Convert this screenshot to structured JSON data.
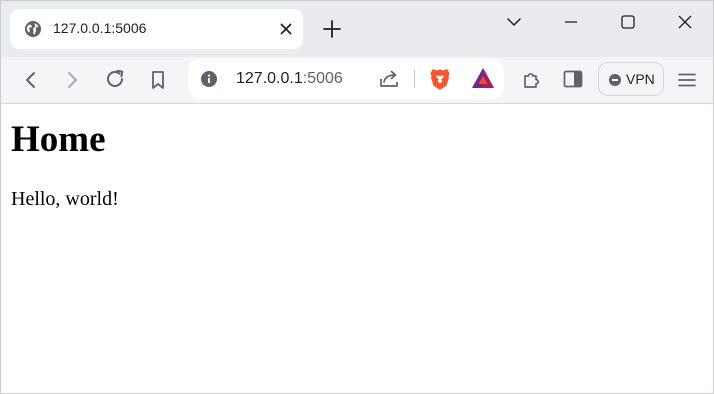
{
  "tab": {
    "title": "127.0.0.1:5006",
    "favicon": "globe-icon"
  },
  "address_bar": {
    "host": "127.0.0.1",
    "port": ":5006"
  },
  "toolbar": {
    "vpn_label": "VPN"
  },
  "page": {
    "heading": "Home",
    "paragraph": "Hello, world!"
  },
  "colors": {
    "tabstrip": "#e9ebef",
    "toolbar": "#f4f5f7",
    "icon": "#5f6368",
    "brave_orange": "#fb542b",
    "bat_purple": "#662d91"
  }
}
